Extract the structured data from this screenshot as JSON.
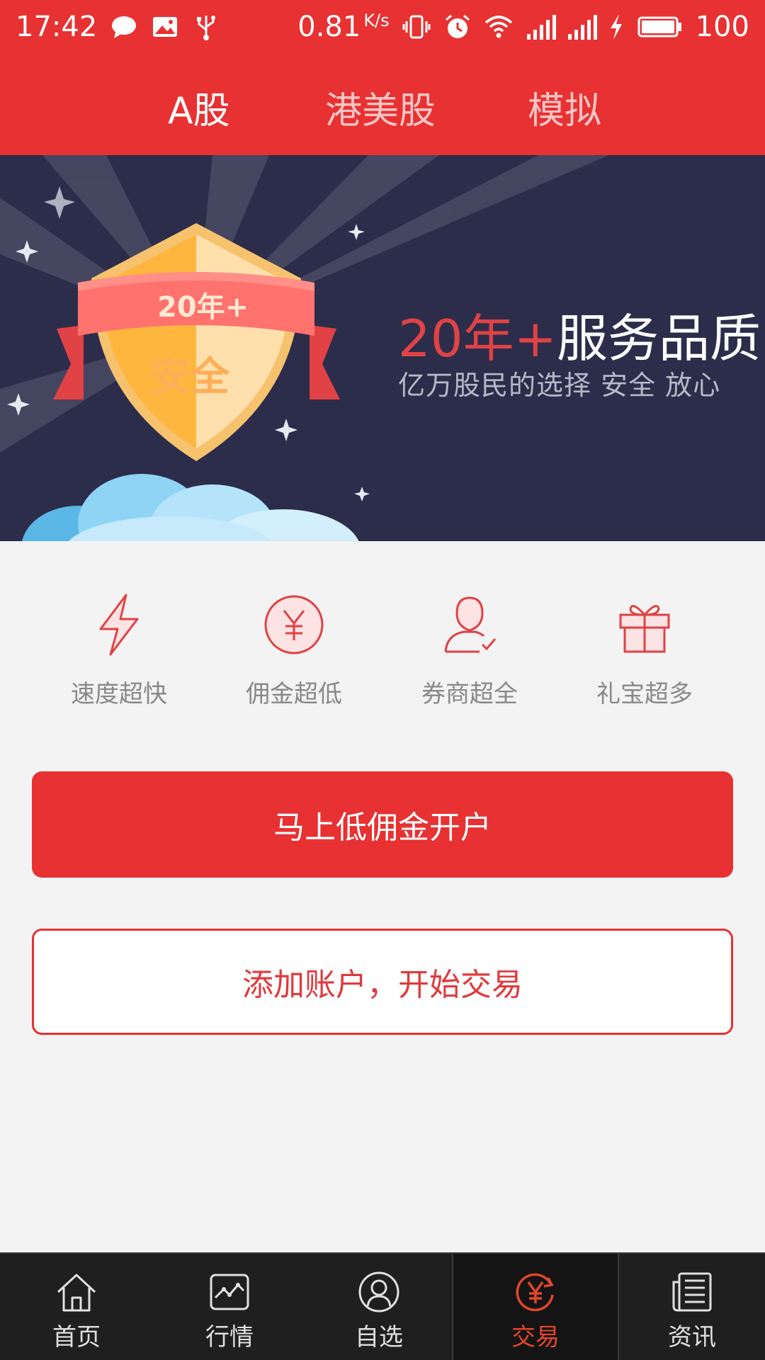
{
  "status_bar": {
    "time": "17:42",
    "speed": "0.81",
    "speed_unit": "K/s",
    "battery": "100"
  },
  "top_tabs": [
    {
      "label": "A股",
      "active": true
    },
    {
      "label": "港美股",
      "active": false
    },
    {
      "label": "模拟",
      "active": false
    }
  ],
  "banner": {
    "badge_top": "20年+",
    "badge_main": "安全",
    "headline_accent": "20年+",
    "headline_rest": "服务品质",
    "subtitle": "亿万股民的选择 安全 放心"
  },
  "features": [
    {
      "label": "速度超快",
      "icon": "lightning-icon"
    },
    {
      "label": "佣金超低",
      "icon": "yuan-circle-icon"
    },
    {
      "label": "券商超全",
      "icon": "user-check-icon"
    },
    {
      "label": "礼宝超多",
      "icon": "gift-icon"
    }
  ],
  "buttons": {
    "open_account": "马上低佣金开户",
    "add_account": "添加账户，开始交易"
  },
  "bottom_nav": [
    {
      "label": "首页",
      "icon": "home-icon",
      "active": false
    },
    {
      "label": "行情",
      "icon": "chart-icon",
      "active": false
    },
    {
      "label": "自选",
      "icon": "person-icon",
      "active": false
    },
    {
      "label": "交易",
      "icon": "trade-yuan-icon",
      "active": true
    },
    {
      "label": "资讯",
      "icon": "news-icon",
      "active": false
    }
  ],
  "colors": {
    "brand_red": "#e83132",
    "banner_bg": "#2b2d4a",
    "nav_bg": "#1f1f1f",
    "nav_active": "#e2462c"
  }
}
